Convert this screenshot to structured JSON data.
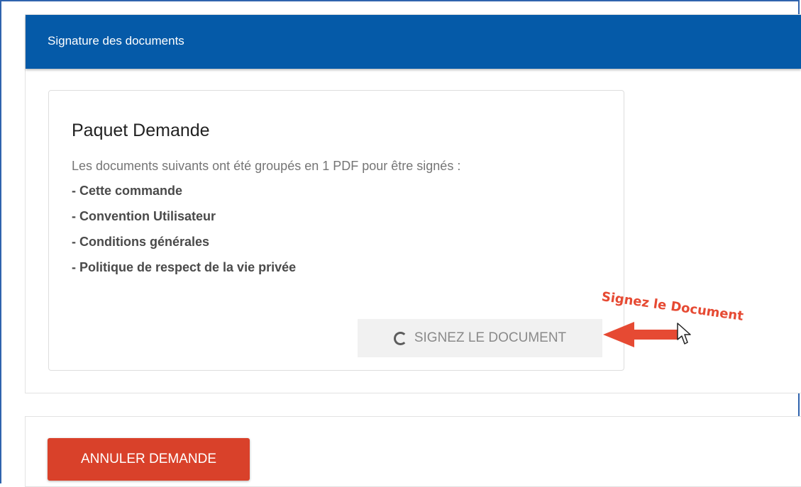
{
  "panel": {
    "header_title": "Signature des documents"
  },
  "card": {
    "title": "Paquet Demande",
    "description": "Les documents suivants ont été groupés en 1 PDF pour être signés :",
    "documents": [
      "- Cette commande",
      "- Convention Utilisateur",
      "- Conditions générales",
      "- Politique de respect de la vie privée"
    ],
    "sign_button_label": "SIGNEZ LE DOCUMENT"
  },
  "annotation": {
    "text": "Signez le Document",
    "color": "#e64a33"
  },
  "footer": {
    "cancel_button_label": "ANNULER DEMANDE"
  },
  "colors": {
    "header_bg": "#055aa8",
    "cancel_bg": "#d9412a",
    "frame_border": "#2f63ad"
  },
  "icons": {
    "spinner": "loading-spinner-icon",
    "arrow": "left-arrow-icon",
    "cursor": "mouse-pointer-icon"
  }
}
